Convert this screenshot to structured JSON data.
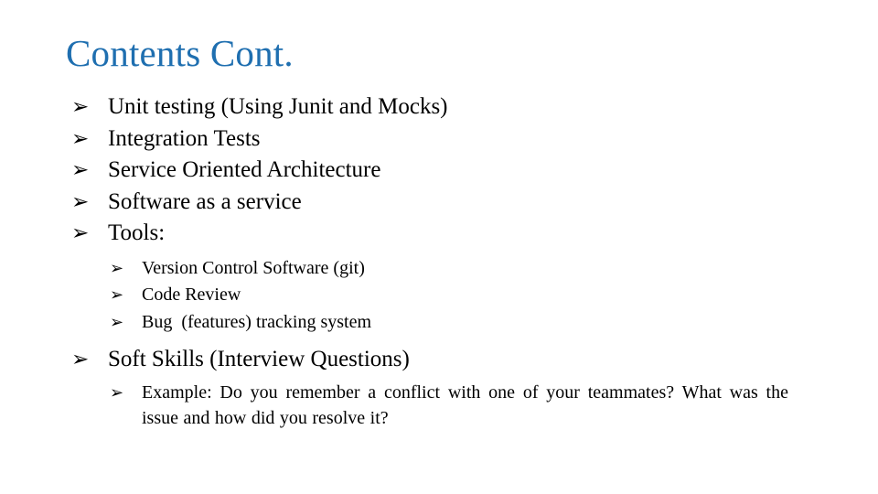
{
  "slide": {
    "title": "Contents Cont.",
    "title_color": "#1f6fb0",
    "background_color": "#ffffff",
    "bullet_glyph": "➢",
    "level1_items": [
      {
        "text": "Unit testing (Using Junit and Mocks)"
      },
      {
        "text": "Integration Tests"
      },
      {
        "text": "Service Oriented Architecture"
      },
      {
        "text": "Software as a service"
      },
      {
        "text": "Tools:"
      }
    ],
    "tools_subitems": [
      {
        "text": "Version Control Software (git)"
      },
      {
        "text": "Code Review"
      },
      {
        "text": "Bug  (features) tracking system"
      }
    ],
    "soft_skills": {
      "text": "Soft Skills (Interview Questions)"
    },
    "soft_skills_subitems": [
      {
        "text": "Example: Do you remember a conflict with one of your teammates? What was the issue and how did you resolve it?"
      }
    ]
  }
}
